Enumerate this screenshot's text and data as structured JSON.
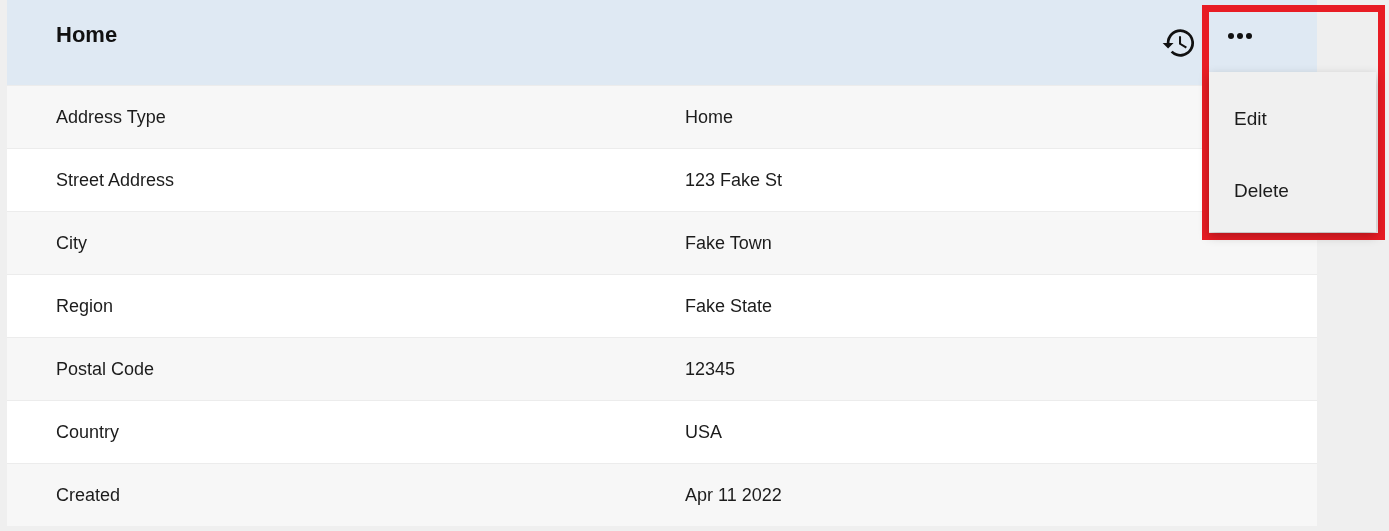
{
  "card": {
    "title": "Home"
  },
  "rows": [
    {
      "label": "Address Type",
      "value": "Home"
    },
    {
      "label": "Street Address",
      "value": "123 Fake St"
    },
    {
      "label": "City",
      "value": "Fake Town"
    },
    {
      "label": "Region",
      "value": "Fake State"
    },
    {
      "label": "Postal Code",
      "value": "12345"
    },
    {
      "label": "Country",
      "value": "USA"
    },
    {
      "label": "Created",
      "value": "Apr 11 2022"
    }
  ],
  "menu": {
    "expanded": true,
    "highlighted": true,
    "items": [
      {
        "label": "Edit"
      },
      {
        "label": "Delete"
      }
    ]
  }
}
